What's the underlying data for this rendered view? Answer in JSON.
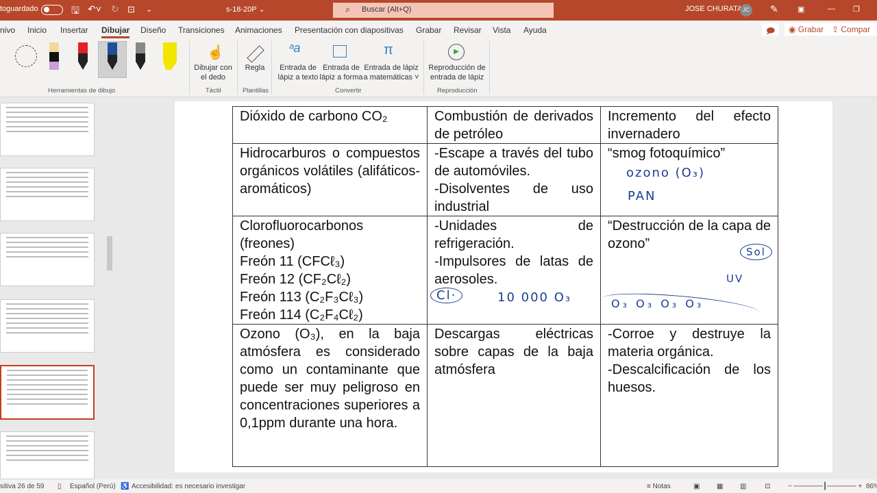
{
  "titlebar": {
    "autosave": "toguardado",
    "filename": "s-18-20P ⌄",
    "search": "Buscar (Alt+Q)",
    "user": "JOSE CHURATA",
    "initials": "JC"
  },
  "tabs": [
    "nivo",
    "Inicio",
    "Insertar",
    "Dibujar",
    "Diseño",
    "Transiciones",
    "Animaciones",
    "Presentación con diapositivas",
    "Grabar",
    "Revisar",
    "Vista",
    "Ayuda"
  ],
  "actions": {
    "record": "◉ Grabar",
    "share": "⇪ Compar"
  },
  "ribbon": {
    "groups": [
      "Herramientas de dibujo",
      "Táctil",
      "Plantillas",
      "Convertir",
      "Reproducción"
    ],
    "draw_finger": [
      "Dibujar con",
      "el dedo"
    ],
    "ruler": "Regla",
    "ink_text": [
      "Entrada de",
      "lápiz a texto"
    ],
    "ink_shape": [
      "Entrada de",
      "lápiz a forma"
    ],
    "ink_math": [
      "Entrada de lápiz",
      "a matemáticas ˅"
    ],
    "replay": [
      "Reproducción de",
      "entrada de lápiz"
    ]
  },
  "table": {
    "rows": [
      [
        "Dióxido de carbono CO₂",
        "Combustión de derivados de petróleo",
        "Incremento del efecto invernadero"
      ],
      [
        "Hidrocarburos o compuestos orgánicos volátiles (alifáticos-aromáticos)",
        "-Escape a través del tubo de automóviles.\n-Disolventes de uso industrial",
        "“smog fotoquímico”"
      ],
      [
        "Clorofluorocarbonos (freones)\nFreón 11 (CFCℓ₃)\nFreón 12 (CF₂Cℓ₂)\nFreón 113 (C₂F₃Cℓ₃)\nFreón 114 (C₂F₄Cℓ₂)",
        "-Unidades de refrigeración.\n-Impulsores de latas de aerosoles.",
        "“Destrucción de la capa de ozono”"
      ],
      [
        "Ozono (O₃), en la baja atmósfera es considerado como un contaminante que puede ser muy peligroso en concentraciones superiores a 0,1ppm durante una hora.",
        "Descargas eléctricas sobre capas de la baja atmósfera",
        "-Corroe y destruye la materia orgánica.\n-Descalcificación de los huesos."
      ]
    ]
  },
  "ink": {
    "ozono": "ozono (O₃)",
    "pan": "PAN",
    "sol": "Sol",
    "uv": "UV",
    "cl": "Cl·",
    "count": "10 000 O₃",
    "o3row": "O₃ O₃ O₃ O₃"
  },
  "status": {
    "slide": "sitiva 26 de 59",
    "lang": "Español (Perú)",
    "access": "Accesibilidad: es necesario investigar",
    "notes": "≡ Notas",
    "zoom": "86%"
  },
  "colors": {
    "accent": "#b7472a",
    "ink": "#1a3f8f"
  }
}
